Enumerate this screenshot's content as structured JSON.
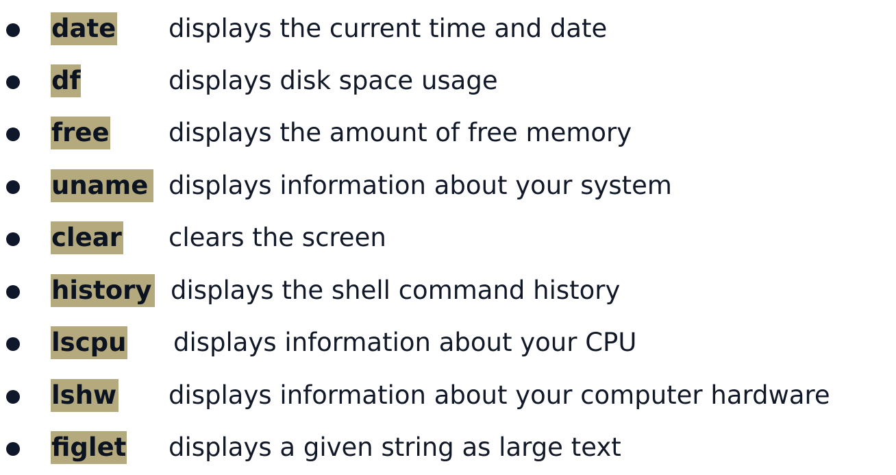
{
  "commands": [
    {
      "name": "date",
      "description": "displays the current time and date"
    },
    {
      "name": "df",
      "description": "displays disk space usage"
    },
    {
      "name": "free",
      "description": "displays the amount of free memory"
    },
    {
      "name": "uname",
      "description": "displays information about your system"
    },
    {
      "name": "clear",
      "description": "clears the screen"
    },
    {
      "name": "history",
      "description": "displays the shell command history"
    },
    {
      "name": "lscpu",
      "description": "displays information about your CPU"
    },
    {
      "name": "lshw",
      "description": "displays information about your computer hardware"
    },
    {
      "name": "figlet",
      "description": "displays a given string as large text"
    }
  ],
  "colors": {
    "highlight": "#b5aa7e",
    "text": "#111827",
    "bullet": "#0f172a"
  }
}
